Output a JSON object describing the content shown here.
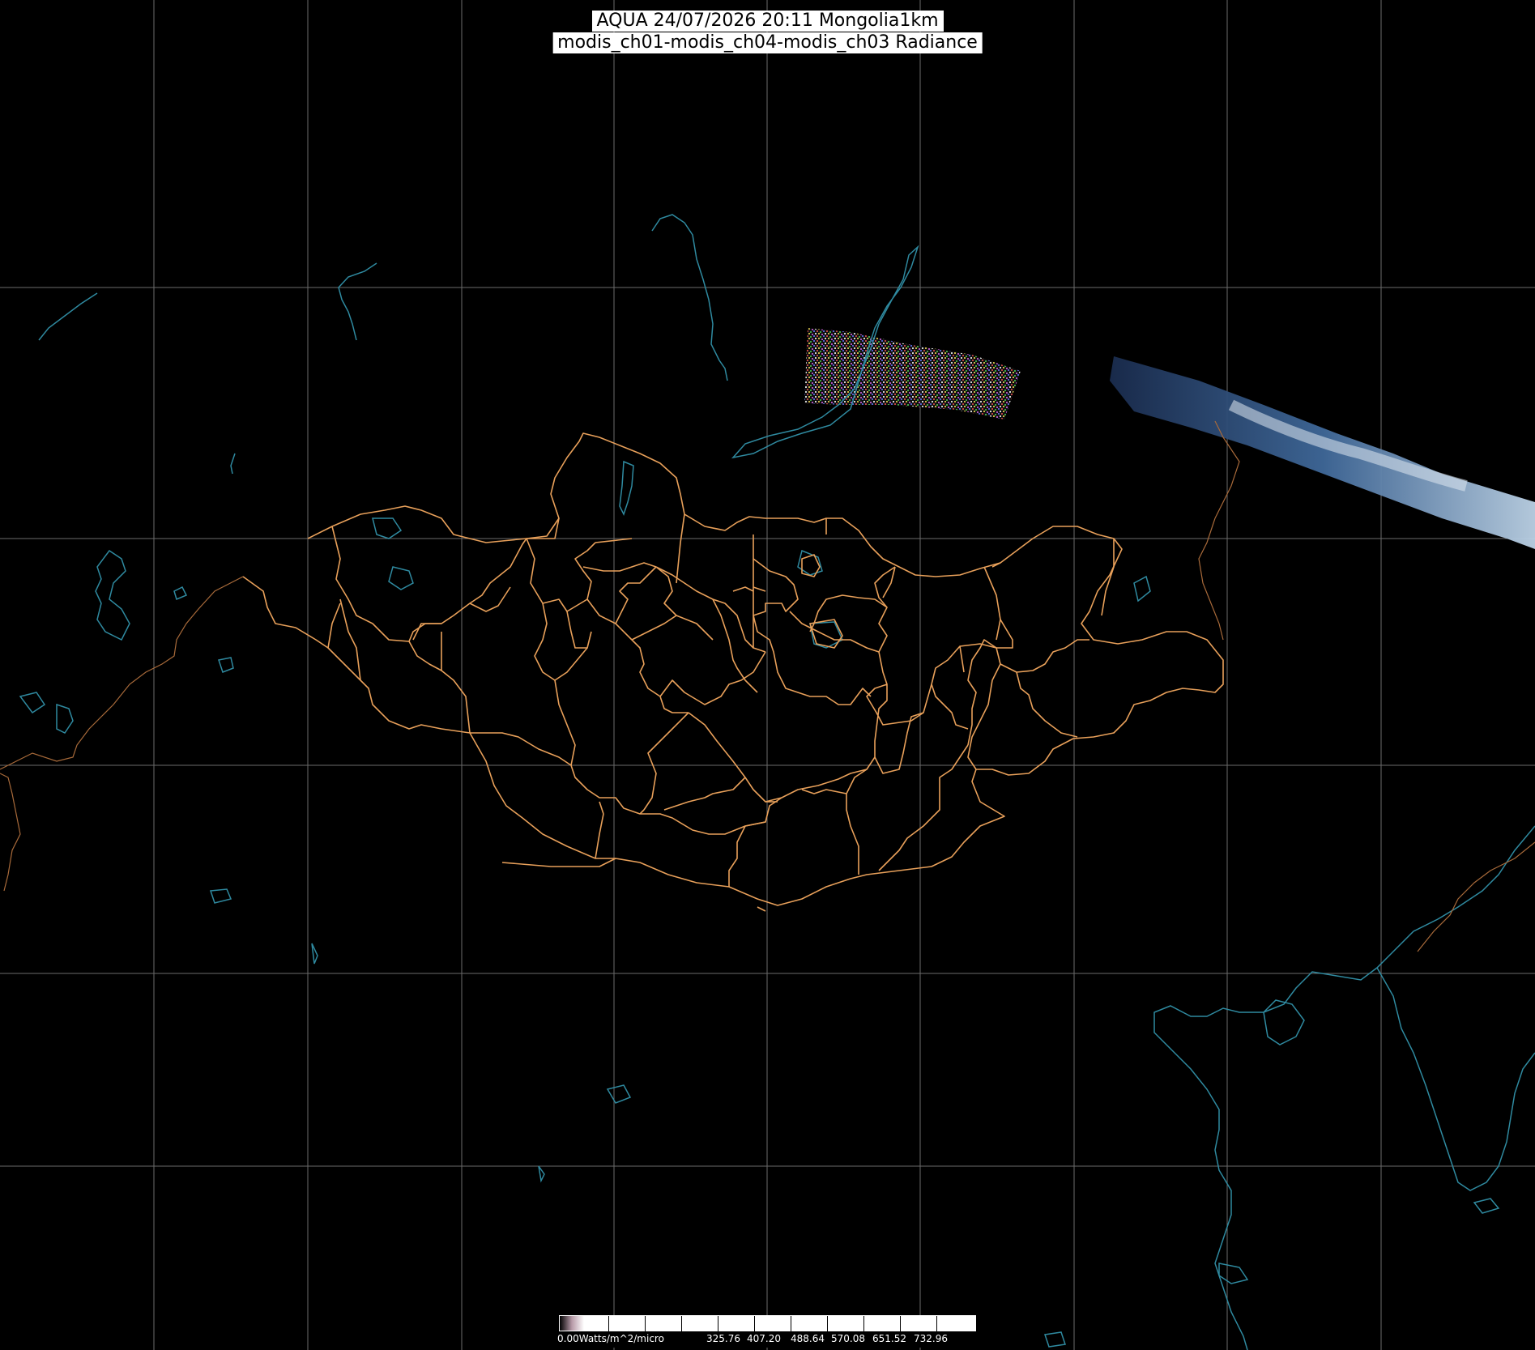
{
  "header": {
    "line1": "AQUA 24/07/2026 20:11 Mongolia1km",
    "line2": "modis_ch01-modis_ch04-modis_ch03 Radiance"
  },
  "legend": {
    "unit_label": "0.00Watts/m^2/micro",
    "ticks": [
      "325.76",
      "407.20",
      "488.64",
      "570.08",
      "651.52",
      "732.96"
    ]
  },
  "colors": {
    "background": "#000000",
    "graticule": "#6b6b6b",
    "admin_borders": "#e8a05a",
    "coastlines_water": "#2f8aa0",
    "country_borders_outside": "#a86a3a",
    "swath": "#3a5a86"
  },
  "map": {
    "region": "Mongolia",
    "graticule_visible": true,
    "layers": [
      "graticule",
      "coastlines",
      "lakes",
      "rivers",
      "country-borders",
      "province-borders",
      "satellite-swath"
    ]
  }
}
